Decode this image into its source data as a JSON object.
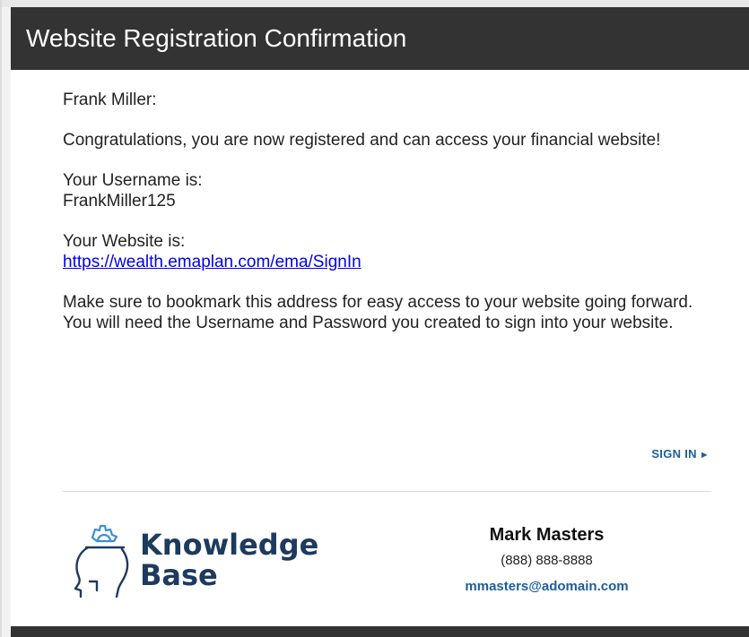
{
  "header": {
    "title": "Website Registration Confirmation"
  },
  "message": {
    "greeting": "Frank Miller:",
    "congrats": "Congratulations, you are now registered and can access your financial website!",
    "username_label": "Your Username is:",
    "username": "FrankMiller125",
    "website_label": "Your Website is:",
    "website_url": "https://wealth.emaplan.com/ema/SignIn",
    "bookmark_note": "Make sure to bookmark this address for easy access to your website going forward. You will need the Username and Password you created to sign into your website."
  },
  "actions": {
    "sign_in_label": "SIGN IN",
    "sign_in_arrow": "►"
  },
  "logo": {
    "line1": "Knowledge",
    "line2": "Base",
    "icon": "head-gear-icon"
  },
  "contact": {
    "name": "Mark Masters",
    "phone": "(888) 888-8888",
    "email": "mmasters@adomain.com"
  },
  "colors": {
    "header_bg": "#333333",
    "link_blue": "#0000ee",
    "accent_blue": "#1a5f99",
    "logo_navy": "#1d3a5f"
  }
}
